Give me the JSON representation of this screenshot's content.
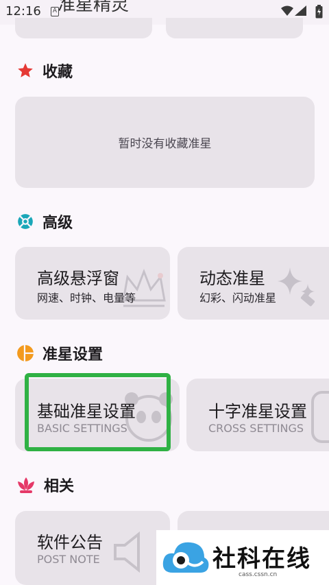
{
  "status": {
    "time": "12:16",
    "notif_glyph": "A"
  },
  "app_title_peek": "准星精灵",
  "favorites": {
    "title": "收藏",
    "empty_text": "暂时没有收藏准星"
  },
  "advanced": {
    "title": "高级",
    "cards": [
      {
        "title": "高级悬浮窗",
        "subtitle": "网速、时钟、电量等"
      },
      {
        "title": "动态准星",
        "subtitle": "幻彩、闪动准星"
      }
    ]
  },
  "crosshair_settings": {
    "title": "准星设置",
    "cards": [
      {
        "title": "基础准星设置",
        "subtitle": "BASIC SETTINGS"
      },
      {
        "title": "十字准星设置",
        "subtitle": "CROSS SETTINGS"
      }
    ]
  },
  "related": {
    "title": "相关",
    "cards": [
      {
        "title": "软件公告",
        "subtitle": "POST NOTE"
      }
    ]
  },
  "watermark": {
    "text": "社科在线",
    "url": "cass.cssn.cn"
  },
  "colors": {
    "highlight": "#2FB144",
    "star": "#E53935",
    "advanced_icon": "#1AA7B8",
    "settings_icon": "#F39A1E",
    "related_icon": "#E53968",
    "card_bg": "#E8E3E9"
  }
}
